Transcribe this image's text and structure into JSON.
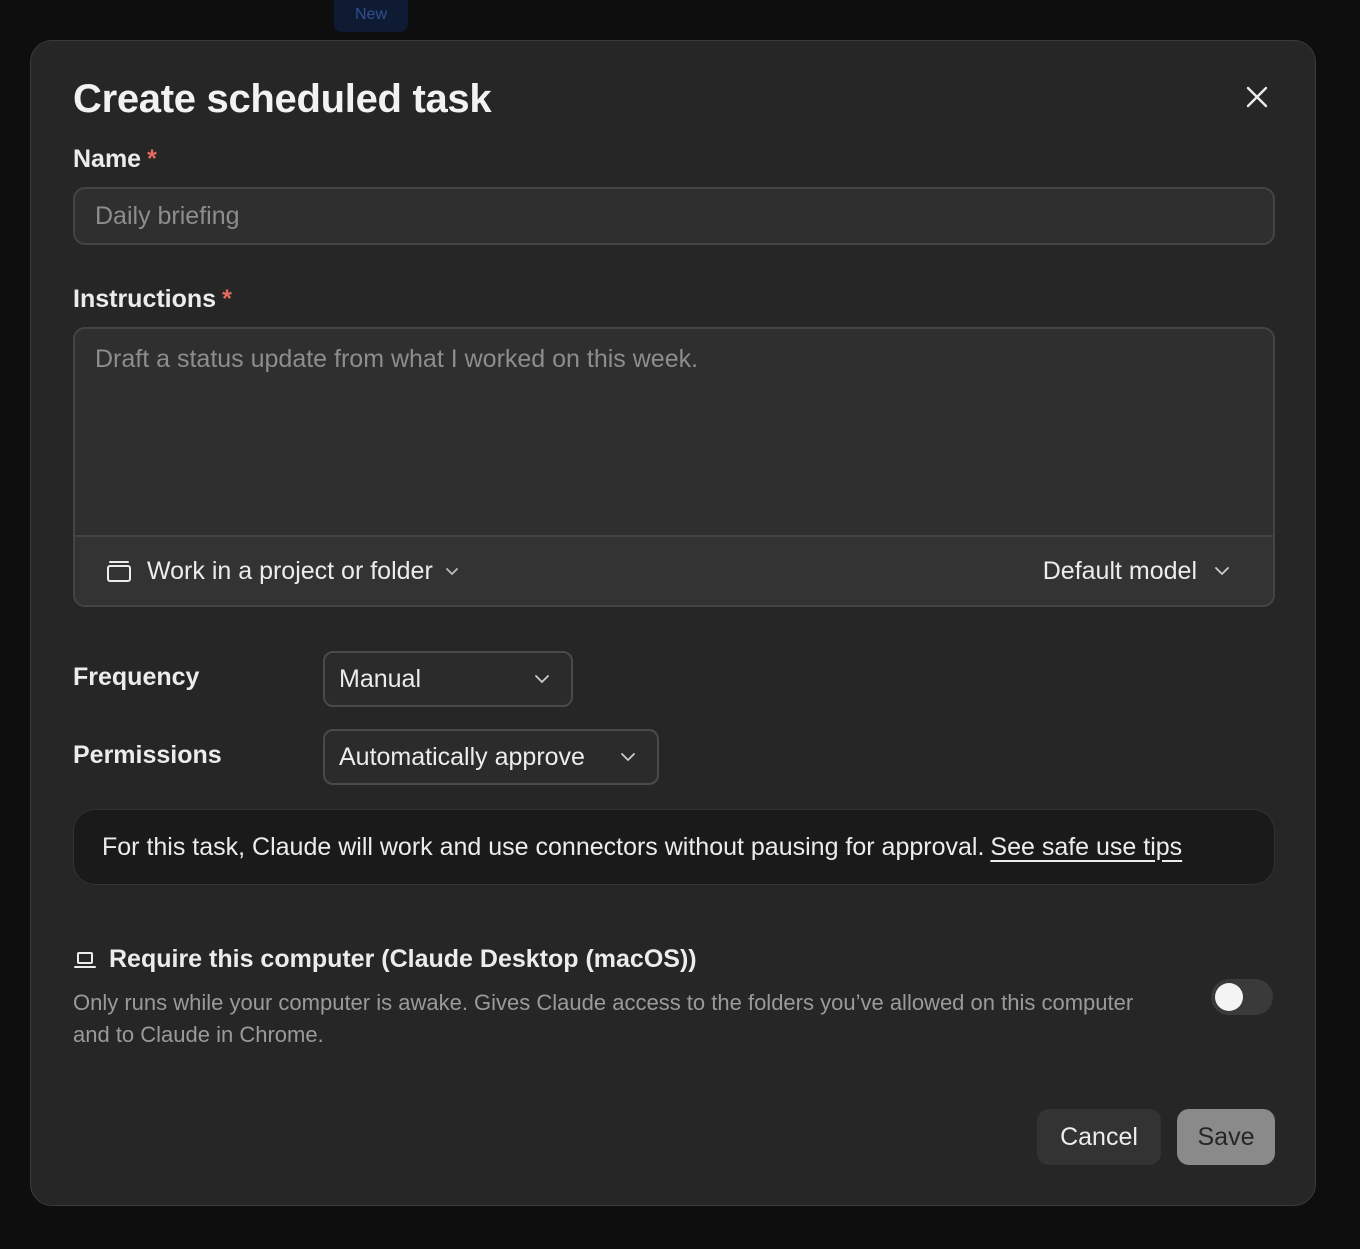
{
  "background": {
    "pill_label": "New",
    "accent": "#0f1a33"
  },
  "dialog": {
    "title": "Create scheduled task",
    "close_icon": "close-icon",
    "name": {
      "label": "Name",
      "required_mark": "*",
      "placeholder": "Daily briefing",
      "value": ""
    },
    "instructions": {
      "label": "Instructions",
      "required_mark": "*",
      "placeholder": "Draft a status update from what I worked on this week.",
      "value": "",
      "project_button": {
        "icon": "folder-icon",
        "label": "Work in a project or folder"
      },
      "model_button": {
        "label": "Default model"
      }
    },
    "frequency": {
      "label": "Frequency",
      "selected": "Manual"
    },
    "permissions": {
      "label": "Permissions",
      "selected": "Automatically approve"
    },
    "notice": {
      "text": "For this task, Claude will work and use connectors without pausing for approval.",
      "link": "See safe use tips"
    },
    "require_computer": {
      "icon": "laptop-icon",
      "title": "Require this computer (Claude Desktop (macOS))",
      "description": "Only runs while your computer is awake. Gives Claude access to the folders you’ve allowed on this computer and to Claude in Chrome.",
      "enabled": false
    },
    "buttons": {
      "cancel": "Cancel",
      "save": "Save"
    }
  },
  "colors": {
    "required": "#e86a5f",
    "modal_bg": "#262626",
    "save_disabled": "#8a8a8a"
  }
}
